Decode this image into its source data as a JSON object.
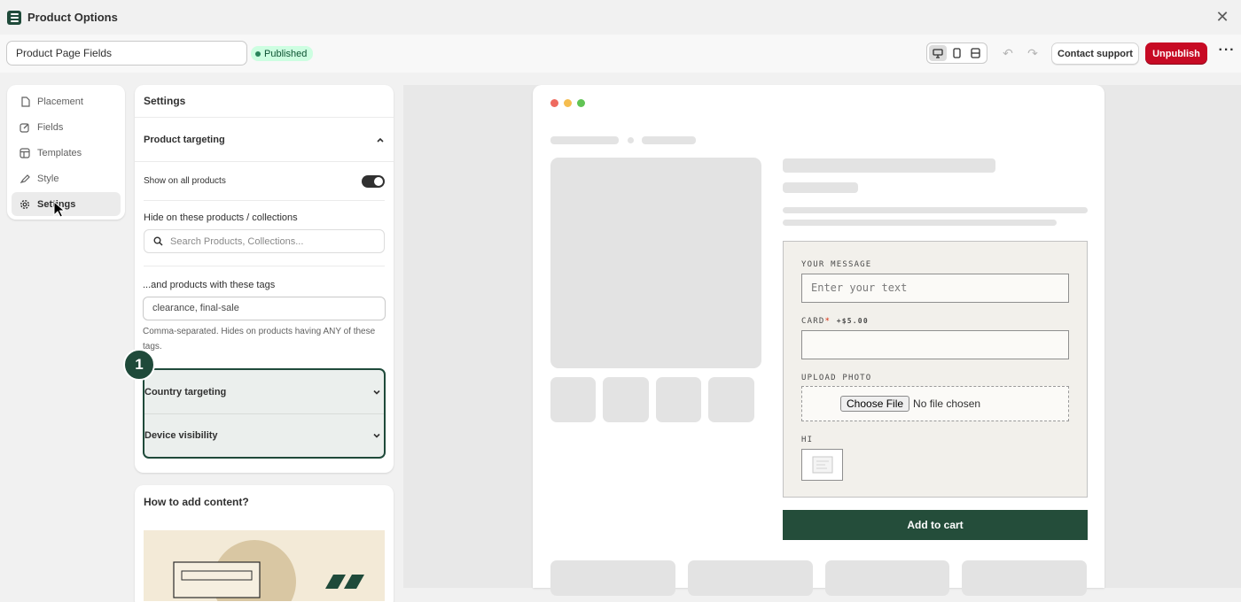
{
  "app": {
    "title": "Product Options"
  },
  "toolbar": {
    "name_value": "Product Page Fields",
    "status_badge": "Published",
    "contact_support": "Contact support",
    "unpublish": "Unpublish"
  },
  "sidebar": {
    "items": [
      {
        "label": "Placement",
        "icon": "page-icon"
      },
      {
        "label": "Fields",
        "icon": "edit-icon"
      },
      {
        "label": "Templates",
        "icon": "template-icon"
      },
      {
        "label": "Style",
        "icon": "brush-icon"
      },
      {
        "label": "Settings",
        "icon": "gear-icon",
        "active": true
      }
    ]
  },
  "settings": {
    "title": "Settings",
    "product_targeting": "Product targeting",
    "show_all_label": "Show on all products",
    "show_all_on": true,
    "hide_label": "Hide on these products / collections",
    "search_placeholder": "Search Products, Collections...",
    "tags_label": "...and products with these tags",
    "tags_value": "clearance, final-sale",
    "tags_help": "Comma-separated. Hides on products having ANY of these tags.",
    "country_targeting": "Country targeting",
    "device_visibility": "Device visibility",
    "step_number": "1"
  },
  "howto": {
    "title": "How to add content?"
  },
  "preview": {
    "message_label": "YOUR MESSAGE",
    "message_placeholder": "Enter your text",
    "card_label": "CARD",
    "card_required": "*",
    "card_price": "+$5.00",
    "upload_label": "UPLOAD PHOTO",
    "choose_file": "Choose File",
    "no_file": "No file chosen",
    "hi_label": "HI",
    "add_to_cart": "Add to cart"
  },
  "colors": {
    "brand_green": "#1f4a3a",
    "published_bg": "#cdfee1",
    "unpublish_red": "#c70a24",
    "cart_green": "#244d3a"
  }
}
